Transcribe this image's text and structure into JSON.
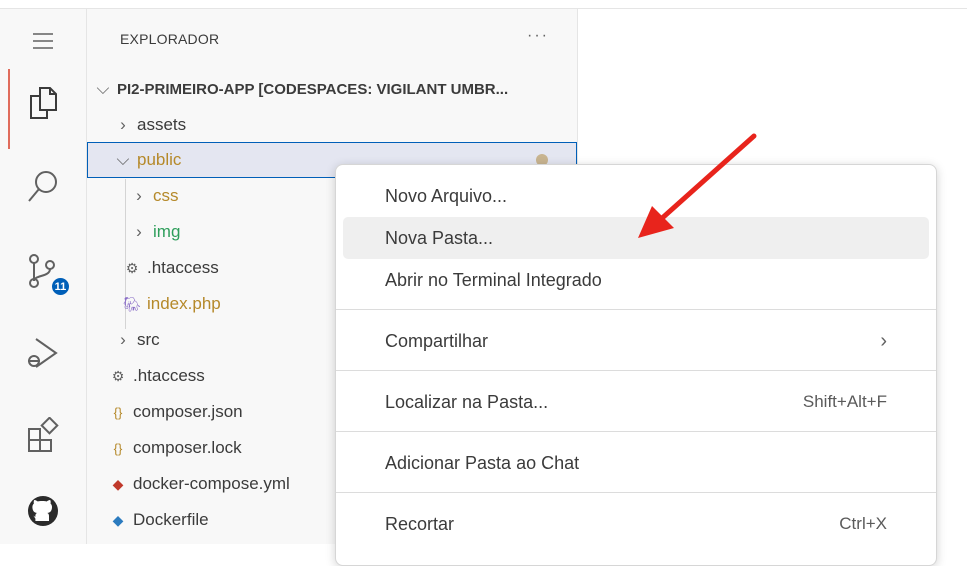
{
  "sidebar": {
    "title": "EXPLORADOR",
    "more": "···",
    "root": "PI2-PRIMEIRO-APP [CODESPACES: VIGILANT UMBR...",
    "items": [
      {
        "label": "assets",
        "kind": "folder",
        "color": "#3b3b3b"
      },
      {
        "label": "public",
        "kind": "folder-open",
        "color": "#b5892a"
      },
      {
        "label": "css",
        "kind": "folder",
        "color": "#b5892a"
      },
      {
        "label": "img",
        "kind": "folder",
        "color": "#2e9e5b"
      },
      {
        "label": ".htaccess",
        "kind": "gear-file",
        "color": "#3b3b3b"
      },
      {
        "label": "index.php",
        "kind": "php-file",
        "color": "#b5892a"
      },
      {
        "label": "src",
        "kind": "folder",
        "color": "#3b3b3b"
      },
      {
        "label": ".htaccess",
        "kind": "gear-file",
        "color": "#3b3b3b"
      },
      {
        "label": "composer.json",
        "kind": "json-file",
        "color": "#3b3b3b"
      },
      {
        "label": "composer.lock",
        "kind": "json-file",
        "color": "#3b3b3b"
      },
      {
        "label": "docker-compose.yml",
        "kind": "docker-file",
        "color": "#3b3b3b"
      },
      {
        "label": "Dockerfile",
        "kind": "docker-file",
        "color": "#3b3b3b"
      }
    ]
  },
  "activity": {
    "badge": "11",
    "icons": [
      "menu-icon",
      "explorer-icon",
      "search-icon",
      "source-control-icon",
      "run-debug-icon",
      "extensions-icon",
      "github-icon"
    ]
  },
  "menu": {
    "items": [
      {
        "label": "Novo Arquivo...",
        "shortcut": ""
      },
      {
        "label": "Nova Pasta...",
        "shortcut": ""
      },
      {
        "label": "Abrir no Terminal Integrado",
        "shortcut": ""
      },
      {
        "label": "Compartilhar",
        "shortcut": ""
      },
      {
        "label": "Localizar na Pasta...",
        "shortcut": "Shift+Alt+F"
      },
      {
        "label": "Adicionar Pasta ao Chat",
        "shortcut": ""
      },
      {
        "label": "Recortar",
        "shortcut": "Ctrl+X"
      }
    ]
  },
  "colors": {
    "accent": "#005fb8",
    "arrow": "#e8241c"
  }
}
